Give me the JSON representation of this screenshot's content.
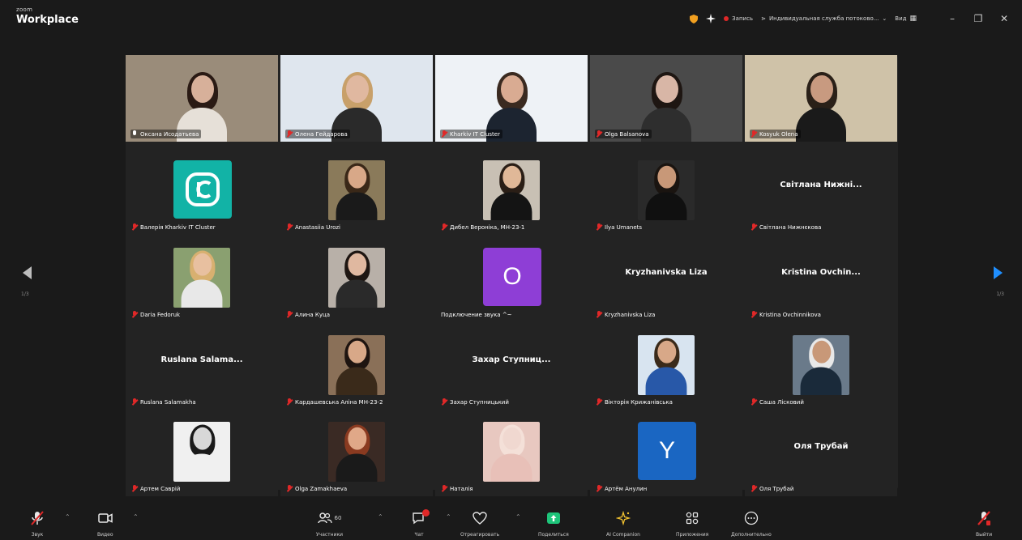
{
  "app": {
    "brand_small": "zoom",
    "brand_name": "Workplace"
  },
  "titlebar": {
    "record_label": "Запись",
    "interpretation_label": "Индивидуальная служба потоково...",
    "view_label": "Вид",
    "colors": {
      "record_dot": "#e02828",
      "shield_dot": "#f2a020",
      "spark": "#f5f5f5"
    }
  },
  "pagination": {
    "left_page": "1/3",
    "right_page": "1/3"
  },
  "participants": [
    {
      "name": "Оксана Исодатьева",
      "type": "video",
      "active": true,
      "mic": "on",
      "bg": "#9a8c7a",
      "skin": "#d7b09a",
      "hair": "#2a1a14",
      "shirt": "#e6e0d8"
    },
    {
      "name": "Олена Гейдарова",
      "type": "video",
      "mic": "muted",
      "bg": "#dfe6ee",
      "skin": "#e0b8a0",
      "hair": "#c8a06a",
      "shirt": "#2a2a2a"
    },
    {
      "name": "Kharkiv IT Cluster",
      "type": "video",
      "mic": "muted",
      "bg": "#eef2f6",
      "skin": "#d9ab92",
      "hair": "#3a2a20",
      "shirt": "#1c2430"
    },
    {
      "name": "Olga Balsanova",
      "type": "video",
      "mic": "muted",
      "bg": "#4a4a4a",
      "skin": "#d8b6a6",
      "hair": "#1e1612",
      "shirt": "#2e2e2e"
    },
    {
      "name": "Kosyuk Olena",
      "type": "video",
      "mic": "muted",
      "bg": "#cfc2a8",
      "skin": "#c89a80",
      "hair": "#2a2018",
      "shirt": "#1a1a1a"
    },
    {
      "name": "Валерія Kharkiv IT Cluster",
      "type": "logo",
      "mic": "muted",
      "color": "#12b3a6"
    },
    {
      "name": "Anastasiia Urozi",
      "type": "photo",
      "mic": "muted",
      "bg": "#8a7a5a",
      "skin": "#d8a888",
      "hair": "#3a2818",
      "shirt": "#1a1a1a"
    },
    {
      "name": "Дибел Вероніка, МН-23-1",
      "type": "photo",
      "mic": "muted",
      "bg": "#c8c0b4",
      "skin": "#e0b898",
      "hair": "#2a1e16",
      "shirt": "#141414"
    },
    {
      "name": "Ilya Umanets",
      "type": "photo",
      "mic": "muted",
      "bg": "#2a2a2a",
      "skin": "#c89878",
      "hair": "#1a1410",
      "shirt": "#101010"
    },
    {
      "name": "Світлана Нижнєкова",
      "type": "text",
      "display": "Світлана Нижні...",
      "mic": "muted"
    },
    {
      "name": "Daria Fedoruk",
      "type": "photo",
      "mic": "muted",
      "bg": "#8aa070",
      "skin": "#e8c0a0",
      "hair": "#d8b070",
      "shirt": "#e8e8e8"
    },
    {
      "name": "Алина Куца",
      "type": "photo",
      "mic": "muted",
      "bg": "#b8b0a8",
      "skin": "#e0b8a0",
      "hair": "#1e1612",
      "shirt": "#2a2a2a"
    },
    {
      "name": "Подключение звука ^~",
      "type": "initial",
      "initial": "О",
      "mic": "none",
      "color": "#8e3ed6"
    },
    {
      "name": "Kryzhanivska Liza",
      "type": "text",
      "display": "Kryzhanivska Liza",
      "mic": "muted"
    },
    {
      "name": "Kristina Ovchinnikova",
      "type": "text",
      "display": "Kristina  Ovchin...",
      "mic": "muted"
    },
    {
      "name": "Ruslana Salamakha",
      "type": "text",
      "display": "Ruslana  Salama...",
      "mic": "muted"
    },
    {
      "name": "Кардашевська Аліна МН-23-2",
      "type": "photo",
      "mic": "muted",
      "bg": "#8a7058",
      "skin": "#d8a888",
      "hair": "#1e1410",
      "shirt": "#3a2a1a"
    },
    {
      "name": "Захар Ступницький",
      "type": "text",
      "display": "Захар  Ступниц...",
      "mic": "muted"
    },
    {
      "name": "Вікторія Крижанівська",
      "type": "photo",
      "mic": "muted",
      "bg": "#d8e4f0",
      "skin": "#d8a888",
      "hair": "#3a2a1a",
      "shirt": "#2858a8"
    },
    {
      "name": "Саша Лісковий",
      "type": "photo",
      "mic": "muted",
      "bg": "#6a7a8a",
      "skin": "#c89878",
      "hair": "#e8e8e8",
      "shirt": "#1a2a3a"
    },
    {
      "name": "Артем Саврій",
      "type": "photo",
      "mic": "muted",
      "bg": "#f0f0f0",
      "skin": "#d8d8d8",
      "hair": "#1a1a1a",
      "shirt": "#f0f0f0"
    },
    {
      "name": "Olga Zamakhaeva",
      "type": "photo",
      "mic": "muted",
      "bg": "#3a2a24",
      "skin": "#e0a888",
      "hair": "#8a3a20",
      "shirt": "#1a1a1a"
    },
    {
      "name": "Наталія",
      "type": "photo",
      "mic": "muted",
      "bg": "#e8c8c0",
      "skin": "#f0d8d0",
      "hair": "#f4e0d8",
      "shirt": "#e8c0b8"
    },
    {
      "name": "Артём Анулин",
      "type": "initial",
      "initial": "Y",
      "mic": "muted",
      "color": "#1a66c2"
    },
    {
      "name": "Оля Трубай",
      "type": "text",
      "display": "Оля Трубай",
      "mic": "muted"
    }
  ],
  "toolbar": {
    "audio": {
      "label": "Звук",
      "icon": "mic-muted-icon"
    },
    "video": {
      "label": "Видео",
      "icon": "camera-icon"
    },
    "participants": {
      "label": "Участники",
      "count": "60",
      "icon": "participants-icon"
    },
    "chat": {
      "label": "Чат",
      "icon": "chat-icon"
    },
    "react": {
      "label": "Отреагировать",
      "icon": "react-icon"
    },
    "share": {
      "label": "Поделиться",
      "icon": "share-screen-icon",
      "color": "#1ec47a"
    },
    "ai": {
      "label": "AI Companion",
      "icon": "ai-companion-icon",
      "color": "#f2c230"
    },
    "apps": {
      "label": "Приложения",
      "icon": "apps-icon"
    },
    "more": {
      "label": "Дополнительно",
      "icon": "more-icon"
    },
    "leave": {
      "label": "Выйти",
      "icon": "leave-icon",
      "color": "#e02828"
    }
  }
}
